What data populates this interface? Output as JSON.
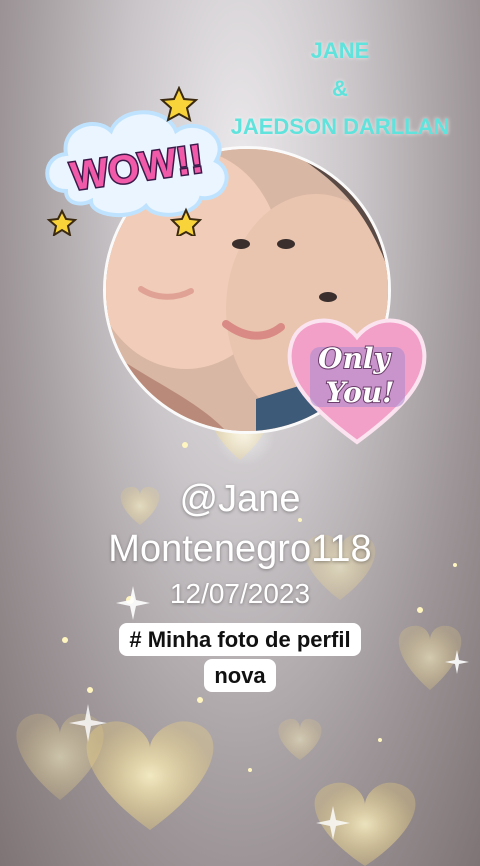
{
  "names": {
    "line1": "JANE",
    "line2": "&",
    "line3": "JAEDSON DARLLAN"
  },
  "stickers": {
    "wow": "WOW!!",
    "only_you_line1": "Only",
    "only_you_line2": "You!"
  },
  "profile": {
    "handle_line1": "@Jane",
    "handle_line2": "Montenegro118",
    "date": "12/07/2023"
  },
  "caption": {
    "line1": "# Minha foto de perfil",
    "line2": "nova"
  },
  "colors": {
    "names": "#5fe3dc",
    "heart_pink": "#f2a0c8",
    "wow_pink": "#f05aa8",
    "gold": "#f5d77a"
  }
}
